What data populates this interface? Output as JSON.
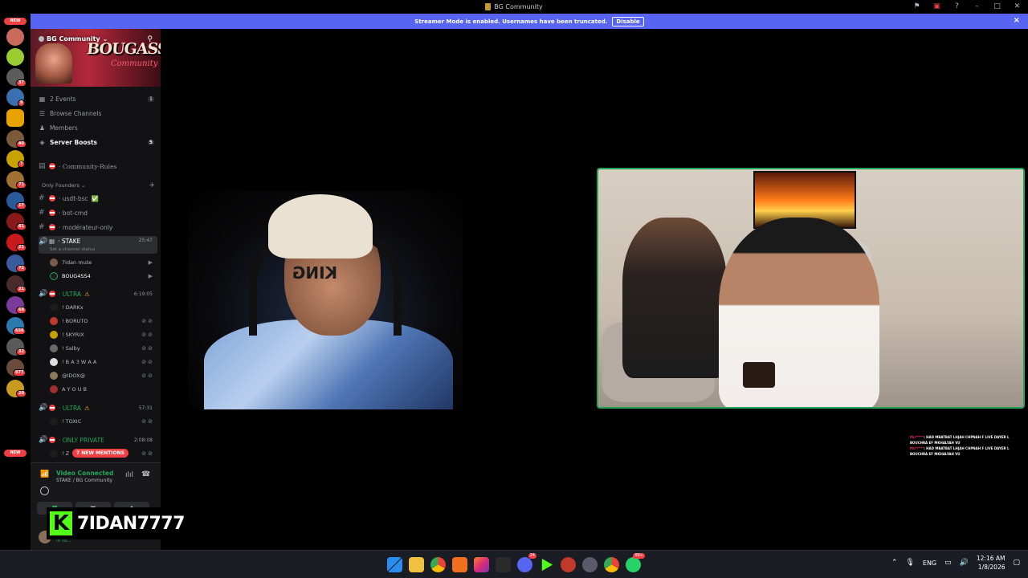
{
  "window": {
    "title": "BG Community"
  },
  "banner": {
    "message": "Streamer Mode is enabled. Usernames have been truncated.",
    "button": "Disable",
    "close": "×"
  },
  "rail": {
    "new_top": "NEW",
    "new_bottom": "NEW",
    "badges": [
      "37",
      "9",
      "42",
      "40",
      "7",
      "71",
      "17",
      "61",
      "21",
      "72",
      "21",
      "68",
      "656",
      "32",
      "977",
      "20"
    ]
  },
  "server": {
    "name": "BG Community",
    "banner_text": "BOUGASSAA",
    "banner_sub": "Community"
  },
  "sidebar": {
    "events_label": "2 Events",
    "events_count": "1",
    "browse_label": "Browse Channels",
    "members_label": "Members",
    "boosts_label": "Server Boosts",
    "boosts_count": "5",
    "rules_channel": "· Community-Rules",
    "category": "Only Founders",
    "channels": {
      "usdt": "· usdt-bsc",
      "bot": "· bot-cmd",
      "mod": "· modérateur-only",
      "stake": "· STAKE",
      "stake_time": "25:47",
      "stake_status": "Set a channel status",
      "ultra1": "· ULTRA",
      "ultra1_time": "6:19:05",
      "ultra2": "· ULTRA",
      "ultra2_time": "57:31",
      "private": "· ONLY PRIVATE",
      "private_time": "2:08:08"
    },
    "stake_users": [
      "7idan mute",
      "BOUG4SS4"
    ],
    "ultra1_users": [
      "! DARKx",
      "! BORUTO",
      "! SKYRIX",
      "! Salby",
      "! B A 3 W A A",
      "@IDOX@",
      "A Y O U B"
    ],
    "ultra2_users": [
      "! TOXIC"
    ],
    "private_user": "! Z",
    "mentions": "7 NEW MENTIONS"
  },
  "voice": {
    "status": "Video Connected",
    "channel": "STAKE / BG Community",
    "user_name": "7idan",
    "user_status": "In vo..."
  },
  "overlay": {
    "kick_logo": "K",
    "handle": "7IDAN7777",
    "beanie_text": "KING"
  },
  "chat": [
    {
      "user": "Mo*****",
      "text": ": HAD MBATBAT LHJAH CHPNAH F LIVE DAYER L BOUCHRA EF MKHALYAH VU"
    },
    {
      "user": "Mo*****",
      "text": ": HAD MBATBAT LHJAH CHPNAH F LIVE DAYER L BOUCHRA EF MKHALYAH VU"
    }
  ],
  "taskbar": {
    "lang": "ENG",
    "time": "12:16 AM",
    "date": "1/8/2026",
    "discord_badge": "24",
    "whatsapp_badge": "99+"
  },
  "colors": {
    "accent": "#5865f2",
    "kick_green": "#53fc18",
    "voice_green": "#23a55a",
    "alert_red": "#f23f43"
  }
}
